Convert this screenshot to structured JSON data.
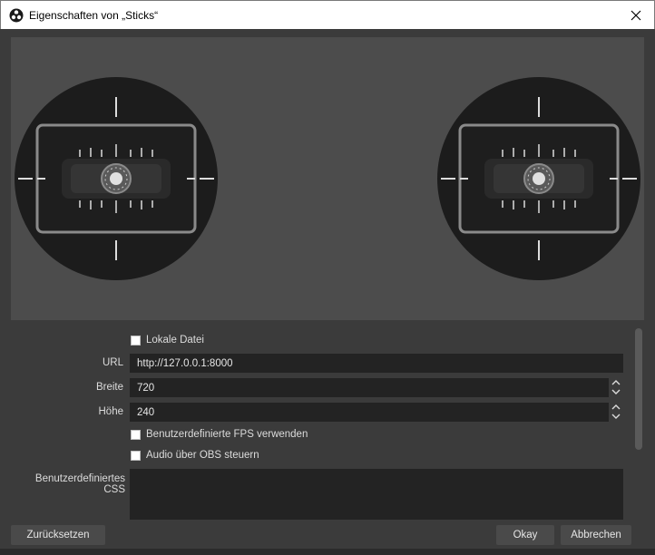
{
  "window": {
    "title": "Eigenschaften von „Sticks“",
    "app_icon": "obs-logo-icon",
    "close_icon": "close-icon"
  },
  "preview": {
    "description_icon": "joystick-gimbal-graphic"
  },
  "form": {
    "local_file": {
      "label": "Lokale Datei",
      "checked": false
    },
    "url": {
      "label": "URL",
      "value": "http://127.0.0.1:8000"
    },
    "width": {
      "label": "Breite",
      "value": "720"
    },
    "height": {
      "label": "Höhe",
      "value": "240"
    },
    "custom_fps": {
      "label": "Benutzerdefinierte FPS verwenden",
      "checked": false
    },
    "obs_audio": {
      "label": "Audio über OBS steuern",
      "checked": false
    },
    "custom_css": {
      "label": "Benutzerdefiniertes CSS",
      "value": ""
    }
  },
  "buttons": {
    "reset": "Zurücksetzen",
    "ok": "Okay",
    "cancel": "Abbrechen"
  },
  "colors": {
    "background": "#3b3b3b",
    "preview_bg": "#4c4c4c",
    "field_bg": "#232323",
    "button_bg": "#4a4a4a"
  }
}
